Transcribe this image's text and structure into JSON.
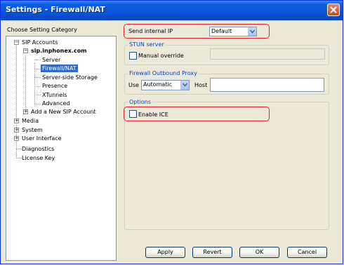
{
  "window": {
    "title": "Settings - Firewall/NAT"
  },
  "sidebar": {
    "heading": "Choose Setting Category",
    "tree": {
      "sip_accounts": "SIP Accounts",
      "account": "sip.inphonex.com",
      "children": [
        "Server",
        "Firewall/NAT",
        "Server-side Storage",
        "Presence",
        "XTunnels",
        "Advanced"
      ],
      "selected": "Firewall/NAT",
      "add_account": "Add a New SIP Account",
      "media": "Media",
      "system": "System",
      "user_interface": "User Interface",
      "diagnostics": "Diagnostics",
      "license_key": "License Key"
    }
  },
  "main": {
    "send_ip": {
      "label": "Send internal IP",
      "value": "Default"
    },
    "stun": {
      "legend": "STUN server",
      "manual_override_label": "Manual override",
      "manual_override_checked": false,
      "value": ""
    },
    "proxy": {
      "legend": "Firewall Outbound Proxy",
      "use_label": "Use",
      "use_value": "Automatic",
      "host_label": "Host",
      "host_value": ""
    },
    "options": {
      "legend": "Options",
      "enable_ice_label": "Enable ICE",
      "enable_ice_checked": false
    }
  },
  "buttons": {
    "apply": "Apply",
    "revert": "Revert",
    "ok": "OK",
    "cancel": "Cancel"
  },
  "colors": {
    "highlight": "#e0232b",
    "titlebar": "#0a54d6",
    "selection": "#316ac5",
    "group_legend": "#0046d5"
  }
}
